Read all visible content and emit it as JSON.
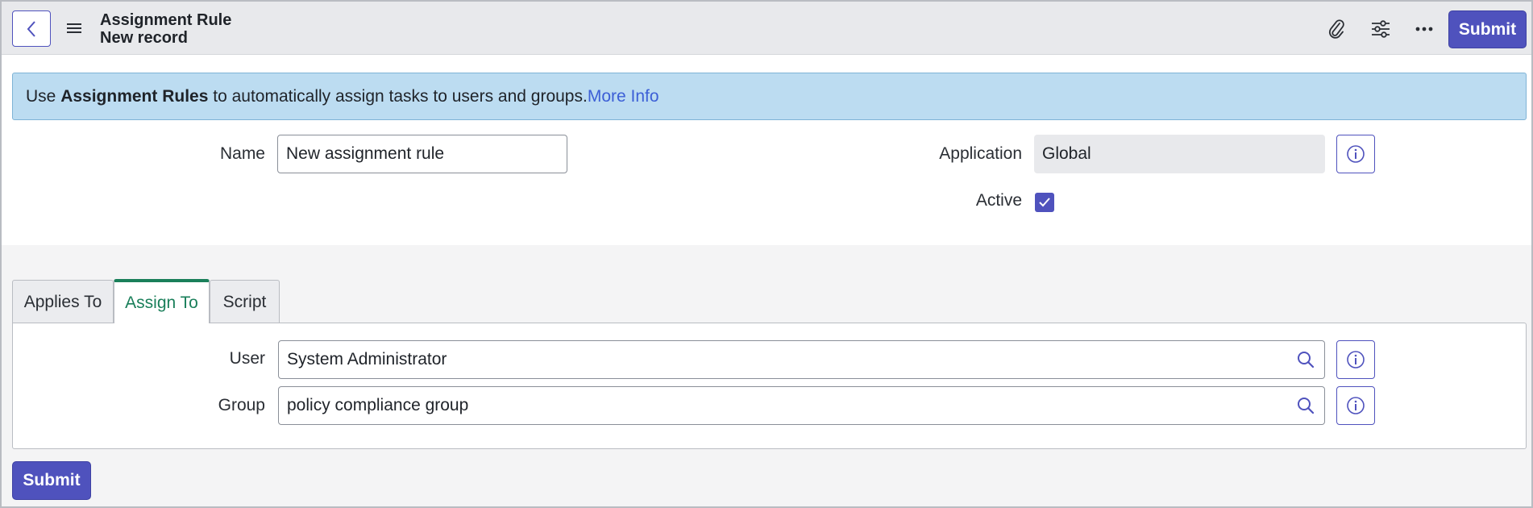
{
  "header": {
    "title": "Assignment Rule",
    "subtitle": "New record",
    "submit_label": "Submit"
  },
  "banner": {
    "prefix": "Use ",
    "bold": "Assignment Rules",
    "suffix": " to automatically assign tasks to users and groups.",
    "link": "More Info"
  },
  "form": {
    "name_label": "Name",
    "name_value": "New assignment rule",
    "application_label": "Application",
    "application_value": "Global",
    "active_label": "Active",
    "active_checked": true
  },
  "tabs": [
    {
      "label": "Applies To",
      "active": false
    },
    {
      "label": "Assign To",
      "active": true
    },
    {
      "label": "Script",
      "active": false
    }
  ],
  "assign_to": {
    "user_label": "User",
    "user_value": "System Administrator",
    "group_label": "Group",
    "group_value": "policy compliance group"
  },
  "footer": {
    "submit_label": "Submit"
  },
  "colors": {
    "accent": "#4f52bd",
    "active_tab": "#1a7f5a",
    "banner_bg": "#bcdcf1",
    "link": "#3c5fd6"
  }
}
